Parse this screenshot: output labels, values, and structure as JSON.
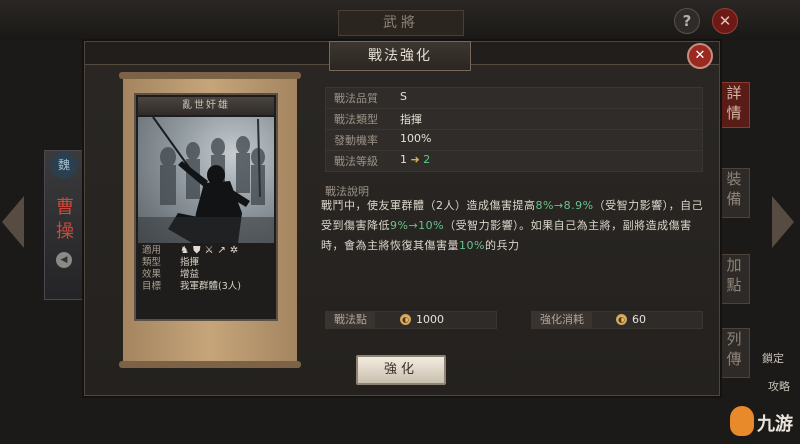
{
  "background": {
    "window_title": "武將",
    "help_label": "?",
    "close_label": "✕",
    "faction": "魏",
    "general_name_1": "曹",
    "general_name_2": "操",
    "side_tabs": [
      "詳",
      "情",
      "裝",
      "備",
      "加",
      "點",
      "列",
      "傳"
    ],
    "side_text_1": "鎖定",
    "side_text_2": "攻略",
    "watermark_text": "九游"
  },
  "modal": {
    "title": "戰法強化",
    "close_icon": "close-icon"
  },
  "card": {
    "name": "亂世奸雄",
    "properties": [
      {
        "key": "適用",
        "value": ""
      },
      {
        "key": "類型",
        "value": "指揮"
      },
      {
        "key": "效果",
        "value": "增益"
      },
      {
        "key": "目標",
        "value": "我軍群體(3人)"
      }
    ],
    "applicable_icons": [
      "cavalry-icon",
      "shield-icon",
      "crossed-swords-icon",
      "spear-icon",
      "wheel-icon"
    ]
  },
  "info": {
    "quality_label": "戰法品質",
    "quality_value": "S",
    "type_label": "戰法類型",
    "type_value": "指揮",
    "rate_label": "發動機率",
    "rate_value": "100%",
    "level_label": "戰法等級",
    "level_from": "1",
    "level_to": "2",
    "desc_label": "戰法說明",
    "desc_part1": "戰鬥中，使友軍群體（2人）造成傷害提高",
    "desc_inc": "8%→8.9%",
    "desc_part2": "（受智力影響），自己受到傷害降低",
    "desc_dec": "9%→10%",
    "desc_part3": "（受智力影響）。如果自己為主將，副將造成傷害時，會為主將恢復其傷害量",
    "desc_heal": "10%",
    "desc_part4": "的兵力"
  },
  "stats": {
    "points_label": "戰法點",
    "points_value": "1000",
    "cost_label": "強化消耗",
    "cost_value": "60"
  },
  "button": {
    "strengthen_label": "強化"
  },
  "colors": {
    "accent_green": "#66c58c",
    "close_red": "#9a2a21",
    "arrow_gold": "#e0b142"
  }
}
